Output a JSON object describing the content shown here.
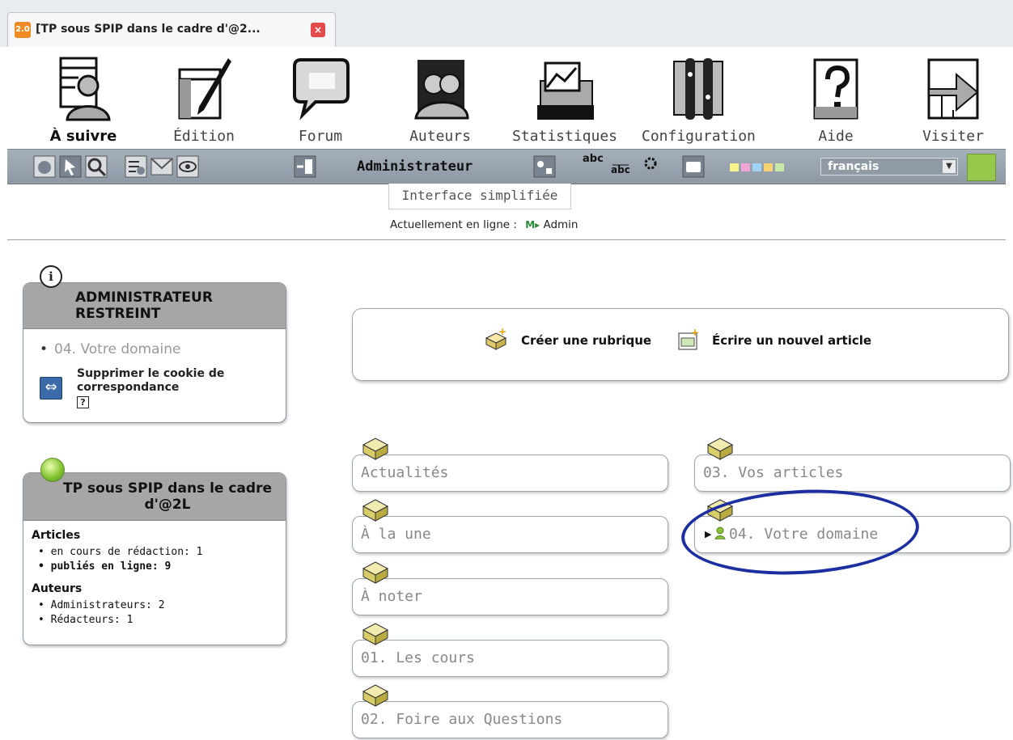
{
  "browser": {
    "tab_title": "[TP sous SPIP dans le cadre d'@2...",
    "favicon": "spip-icon",
    "close": "×"
  },
  "main_nav": [
    {
      "label": "À suivre",
      "icon": "follow-icon",
      "active": true
    },
    {
      "label": "Édition",
      "icon": "edit-pen-icon"
    },
    {
      "label": "Forum",
      "icon": "forum-bubble-icon"
    },
    {
      "label": "Auteurs",
      "icon": "authors-icon"
    },
    {
      "label": "Statistiques",
      "icon": "statistics-icon"
    },
    {
      "label": "Configuration",
      "icon": "configuration-tools-icon"
    },
    {
      "label": "Aide",
      "icon": "help-icon"
    },
    {
      "label": "Visiter",
      "icon": "visit-arrow-icon"
    }
  ],
  "toolbar": {
    "user_label": "Administrateur",
    "abc_label": "abc",
    "language": "français",
    "swatch_colors": [
      "#f5f38a",
      "#f1a4d6",
      "#9ed3f3",
      "#f7d273",
      "#c7e8a6"
    ]
  },
  "interface_mode": "Interface simplifiée",
  "online": {
    "label": "Actuellement en ligne :",
    "badge": "M▸",
    "user": "Admin"
  },
  "restricted_box": {
    "title": "ADMINISTRATEUR RESTREINT",
    "item": "04. Votre domaine",
    "cookie_link": "Supprimer le cookie de correspondance",
    "help": "?"
  },
  "site_box": {
    "title": "TP sous SPIP dans le cadre d'@2L",
    "articles_heading": "Articles",
    "articles_draft": "en cours de rédaction: 1",
    "articles_published": "publiés en ligne: 9",
    "authors_heading": "Auteurs",
    "authors_admins": "Administrateurs: 2",
    "authors_writers": "Rédacteurs: 1"
  },
  "actions": {
    "create_section": "Créer une rubrique",
    "write_article": "Écrire un nouvel article"
  },
  "sections_left": [
    "Actualités",
    "À la une",
    "À noter",
    "01. Les cours",
    "02. Foire aux Questions"
  ],
  "sections_right": [
    "03. Vos articles",
    "04. Votre domaine"
  ],
  "highlight_color": "#1d2fa0"
}
